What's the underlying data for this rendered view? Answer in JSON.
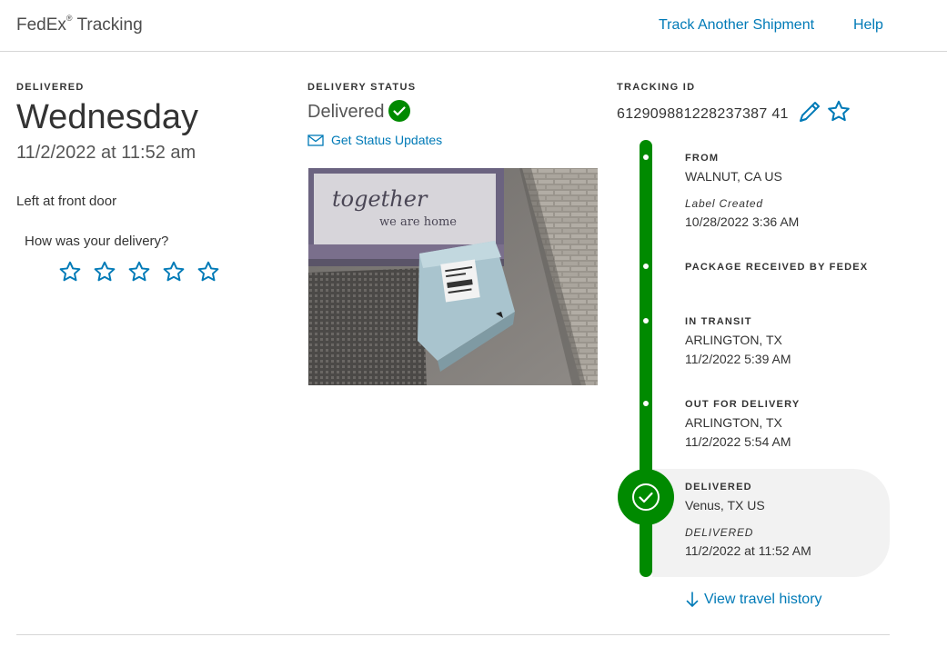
{
  "header": {
    "brand": "FedEx",
    "brand_mark": "®",
    "brand_suffix": "Tracking",
    "track_another": "Track Another Shipment",
    "help": "Help"
  },
  "delivered_col": {
    "label": "DELIVERED",
    "day": "Wednesday",
    "datetime": "11/2/2022 at 11:52 am",
    "note": "Left at front door",
    "rating_prompt": "How was your delivery?",
    "rating_stars": 5
  },
  "status_col": {
    "label": "DELIVERY STATUS",
    "status": "Delivered",
    "updates_link": "Get Status Updates",
    "photo_text_line1": "together",
    "photo_text_line2": "we are home"
  },
  "tracking_col": {
    "label": "TRACKING ID",
    "tracking_id": "612909881228237387 41"
  },
  "timeline": [
    {
      "title": "FROM",
      "line1": "WALNUT, CA US",
      "italic": "Label Created",
      "line2": "10/28/2022 3:36 AM"
    },
    {
      "title": "PACKAGE RECEIVED BY FEDEX"
    },
    {
      "title": "IN TRANSIT",
      "line1": "ARLINGTON, TX",
      "line2": "11/2/2022 5:39 AM"
    },
    {
      "title": "OUT FOR DELIVERY",
      "line1": "ARLINGTON, TX",
      "line2": "11/2/2022 5:54 AM"
    },
    {
      "title": "DELIVERED",
      "line1": "Venus, TX US",
      "italic": "DELIVERED",
      "line2": "11/2/2022 at 11:52 AM"
    }
  ],
  "travel_history": "View travel history",
  "colors": {
    "link": "#007ab7",
    "success_green": "#008a00",
    "text": "#333333",
    "delivered_panel": "#f2f2f2"
  },
  "icons": [
    "check-circle-icon",
    "envelope-icon",
    "pencil-icon",
    "star-outline-icon",
    "arrow-down-icon"
  ]
}
